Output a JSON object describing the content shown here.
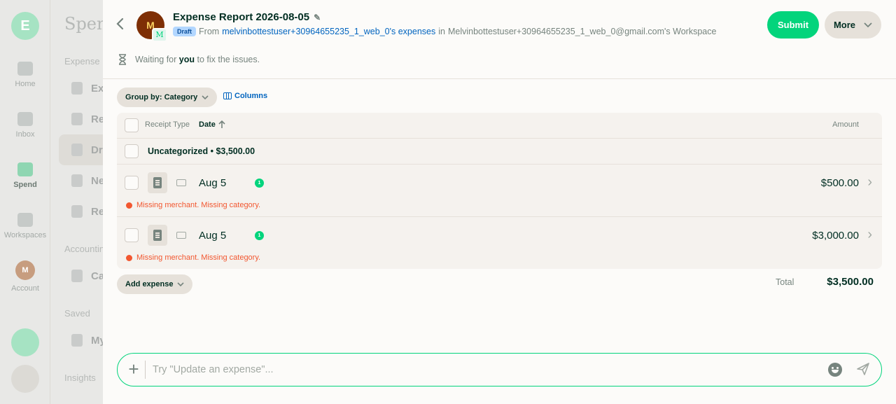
{
  "background": {
    "rail": {
      "items": [
        {
          "label": "Home"
        },
        {
          "label": "Inbox"
        },
        {
          "label": "Spend"
        },
        {
          "label": "Workspaces"
        },
        {
          "label": "Account",
          "avatar_initial": "M"
        }
      ]
    },
    "lnav": {
      "title": "Spend",
      "sections": [
        "Expense r",
        "Accountin",
        "Saved",
        "Insights"
      ],
      "items": [
        "Ex",
        "Re",
        "Dr",
        "Ne",
        "Re",
        "Ca",
        "My"
      ]
    }
  },
  "header": {
    "avatar_initial": "M",
    "workspace_initial": "M",
    "title": "Expense Report 2026-08-05",
    "status_badge": "Draft",
    "from_label": "From",
    "from_link": "melvinbottestuser+30964655235_1_web_0's expenses",
    "in_label": "in",
    "workspace": "Melvinbottestuser+30964655235_1_web_0@gmail.com's Workspace",
    "submit_label": "Submit",
    "more_label": "More",
    "waiting_prefix": "Waiting for",
    "waiting_bold": "you",
    "waiting_suffix": "to fix the issues."
  },
  "toolbar": {
    "group_by_label": "Group by: Category",
    "columns_label": "Columns"
  },
  "table": {
    "columns": {
      "receipt_type": "Receipt Type",
      "date": "Date",
      "amount": "Amount"
    },
    "group": {
      "label": "Uncategorized • $3,500.00"
    },
    "rows": [
      {
        "date": "Aug 5",
        "amount": "$500.00",
        "error": "Missing merchant. Missing category.",
        "chat_count": "1"
      },
      {
        "date": "Aug 5",
        "amount": "$3,000.00",
        "error": "Missing merchant. Missing category.",
        "chat_count": "1"
      }
    ]
  },
  "footer": {
    "add_expense_label": "Add expense",
    "total_label": "Total",
    "total_value": "$3,500.00"
  },
  "composer": {
    "placeholder": "Try \"Update an expense\"..."
  }
}
